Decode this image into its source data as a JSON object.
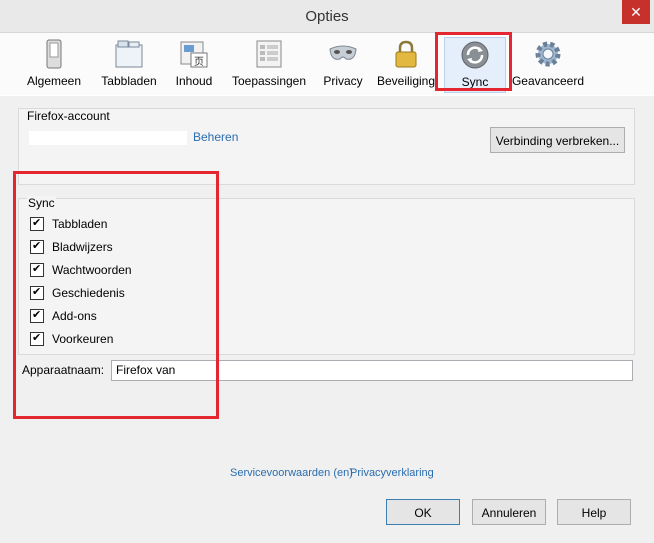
{
  "window": {
    "title": "Opties",
    "close_glyph": "✕"
  },
  "toolbar": {
    "items": [
      {
        "label": "Algemeen",
        "icon": "general-switch-icon"
      },
      {
        "label": "Tabbladen",
        "icon": "tabs-icon"
      },
      {
        "label": "Inhoud",
        "icon": "content-icon"
      },
      {
        "label": "Toepassingen",
        "icon": "applications-icon"
      },
      {
        "label": "Privacy",
        "icon": "privacy-mask-icon"
      },
      {
        "label": "Beveiliging",
        "icon": "security-lock-icon"
      },
      {
        "label": "Sync",
        "icon": "sync-icon",
        "selected": true
      },
      {
        "label": "Geavanceerd",
        "icon": "advanced-gear-icon"
      }
    ]
  },
  "account": {
    "section_label": "Firefox-account",
    "manage_link": "Beheren",
    "disconnect_button": "Verbinding verbreken..."
  },
  "sync": {
    "section_label": "Sync",
    "items": [
      {
        "label": "Tabbladen",
        "checked": true
      },
      {
        "label": "Bladwijzers",
        "checked": true
      },
      {
        "label": "Wachtwoorden",
        "checked": true
      },
      {
        "label": "Geschiedenis",
        "checked": true
      },
      {
        "label": "Add-ons",
        "checked": true
      },
      {
        "label": "Voorkeuren",
        "checked": true
      }
    ]
  },
  "device": {
    "label": "Apparaatnaam:",
    "value": "Firefox van"
  },
  "footer": {
    "terms_link": "Servicevoorwaarden (en)",
    "privacy_link": "Privacyverklaring",
    "ok_button": "OK",
    "cancel_button": "Annuleren",
    "help_button": "Help"
  },
  "colors": {
    "highlight": "#e32630",
    "link": "#2a6db0"
  }
}
